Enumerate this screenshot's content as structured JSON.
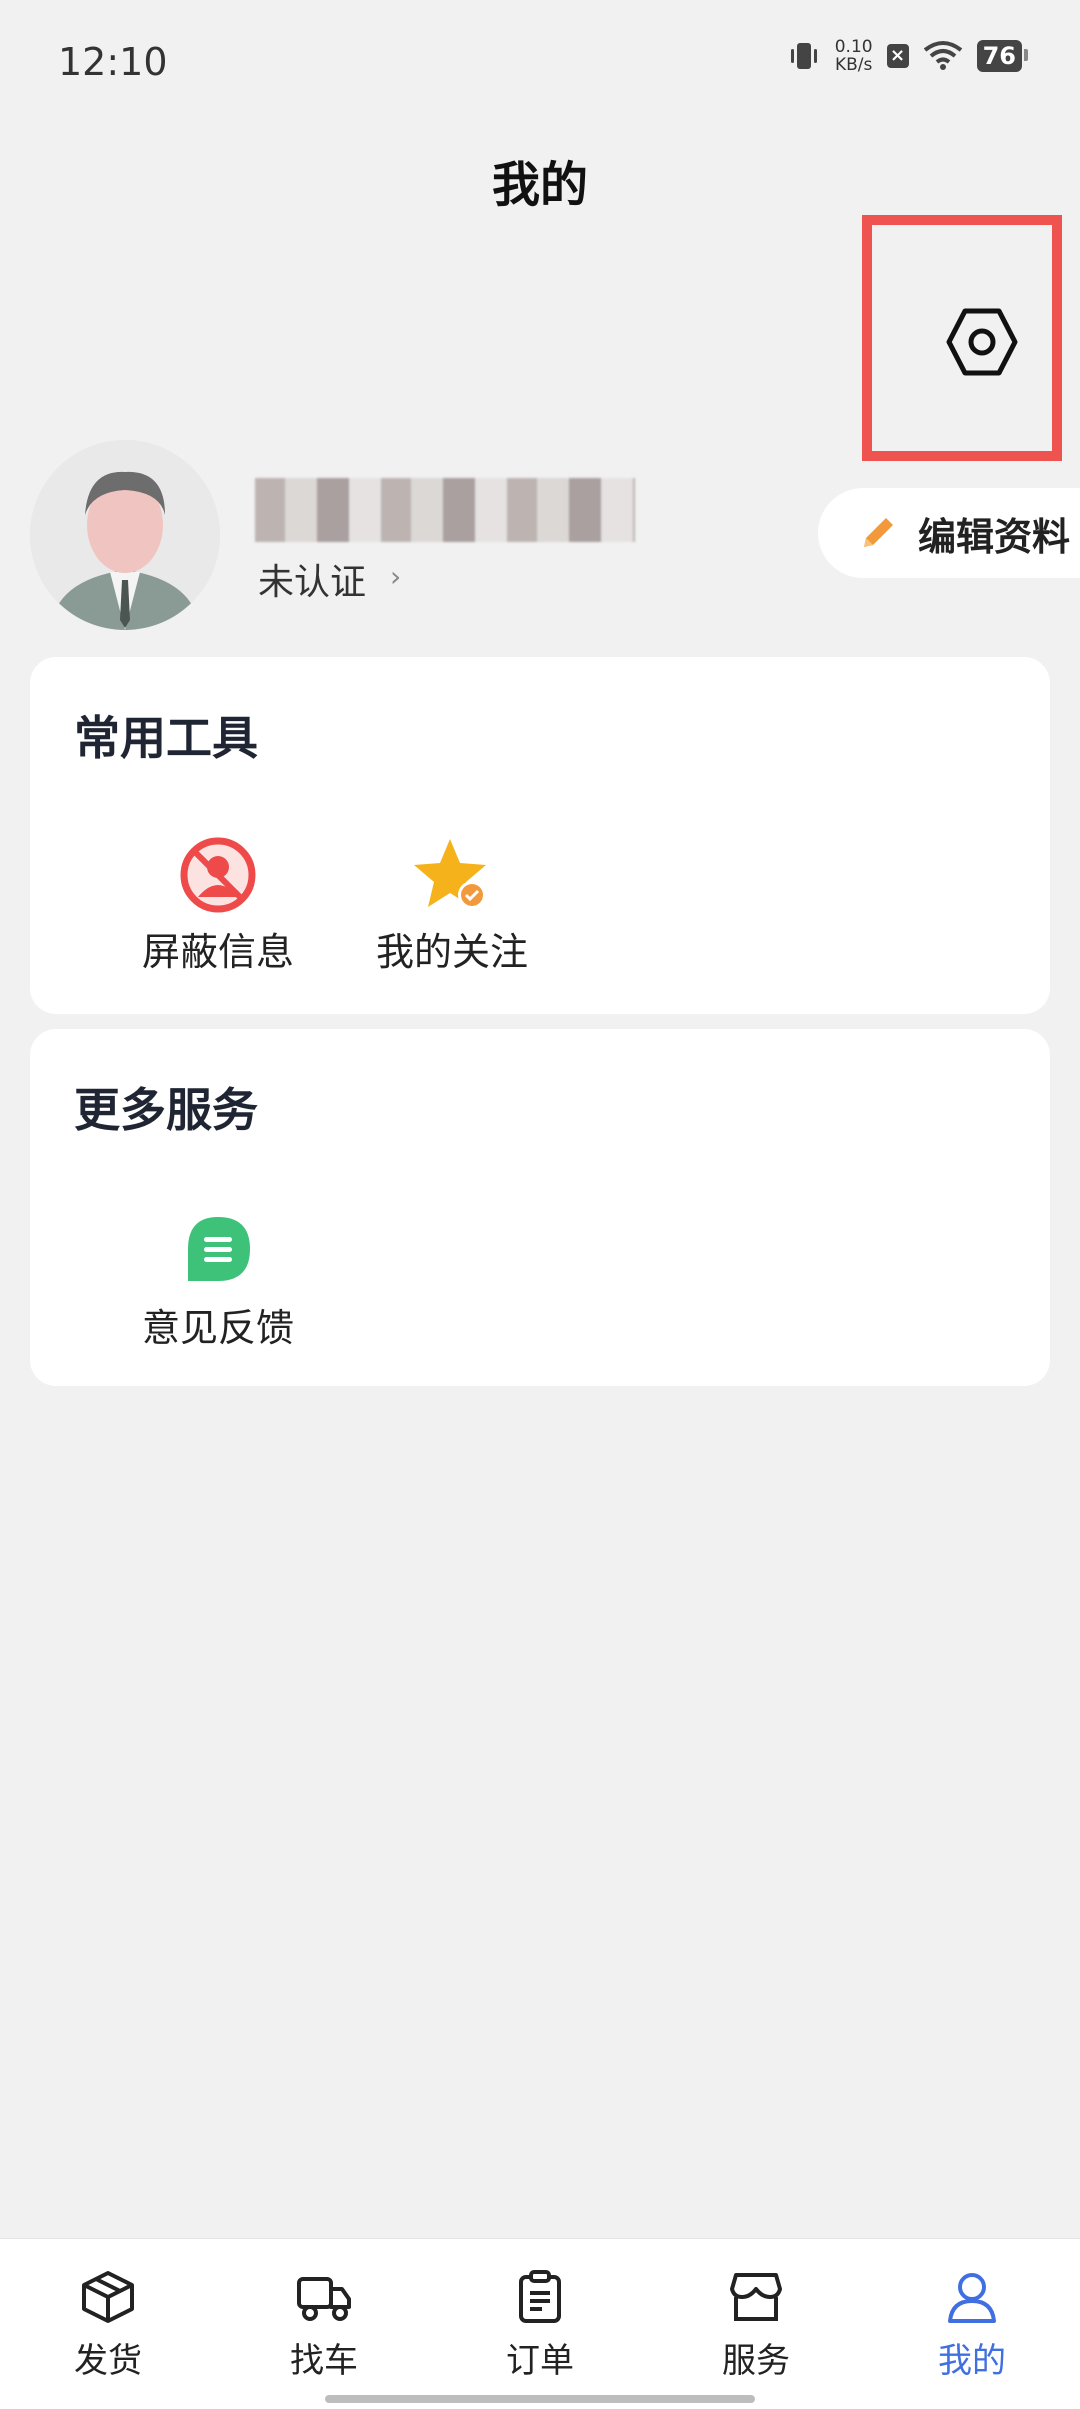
{
  "status_bar": {
    "time": "12:10",
    "net_speed_value": "0.10",
    "net_speed_unit": "KB/s",
    "battery": "76"
  },
  "page_title": "我的",
  "profile": {
    "cert_status": "未认证",
    "edit_label": "编辑资料"
  },
  "tools_card": {
    "title": "常用工具",
    "items": [
      {
        "label": "屏蔽信息",
        "icon": "block-user-icon",
        "color": "#ee4a4a"
      },
      {
        "label": "我的关注",
        "icon": "star-check-icon",
        "color": "#f6b21b"
      }
    ]
  },
  "services_card": {
    "title": "更多服务",
    "items": [
      {
        "label": "意见反馈",
        "icon": "feedback-icon",
        "color": "#3ec27a"
      }
    ]
  },
  "tabbar": {
    "items": [
      {
        "label": "发货",
        "icon": "package-icon"
      },
      {
        "label": "找车",
        "icon": "truck-icon"
      },
      {
        "label": "订单",
        "icon": "clipboard-icon"
      },
      {
        "label": "服务",
        "icon": "store-icon"
      },
      {
        "label": "我的",
        "icon": "user-icon",
        "active": true
      }
    ],
    "active_color": "#3f6fe0"
  },
  "highlight_color": "#ef5350"
}
